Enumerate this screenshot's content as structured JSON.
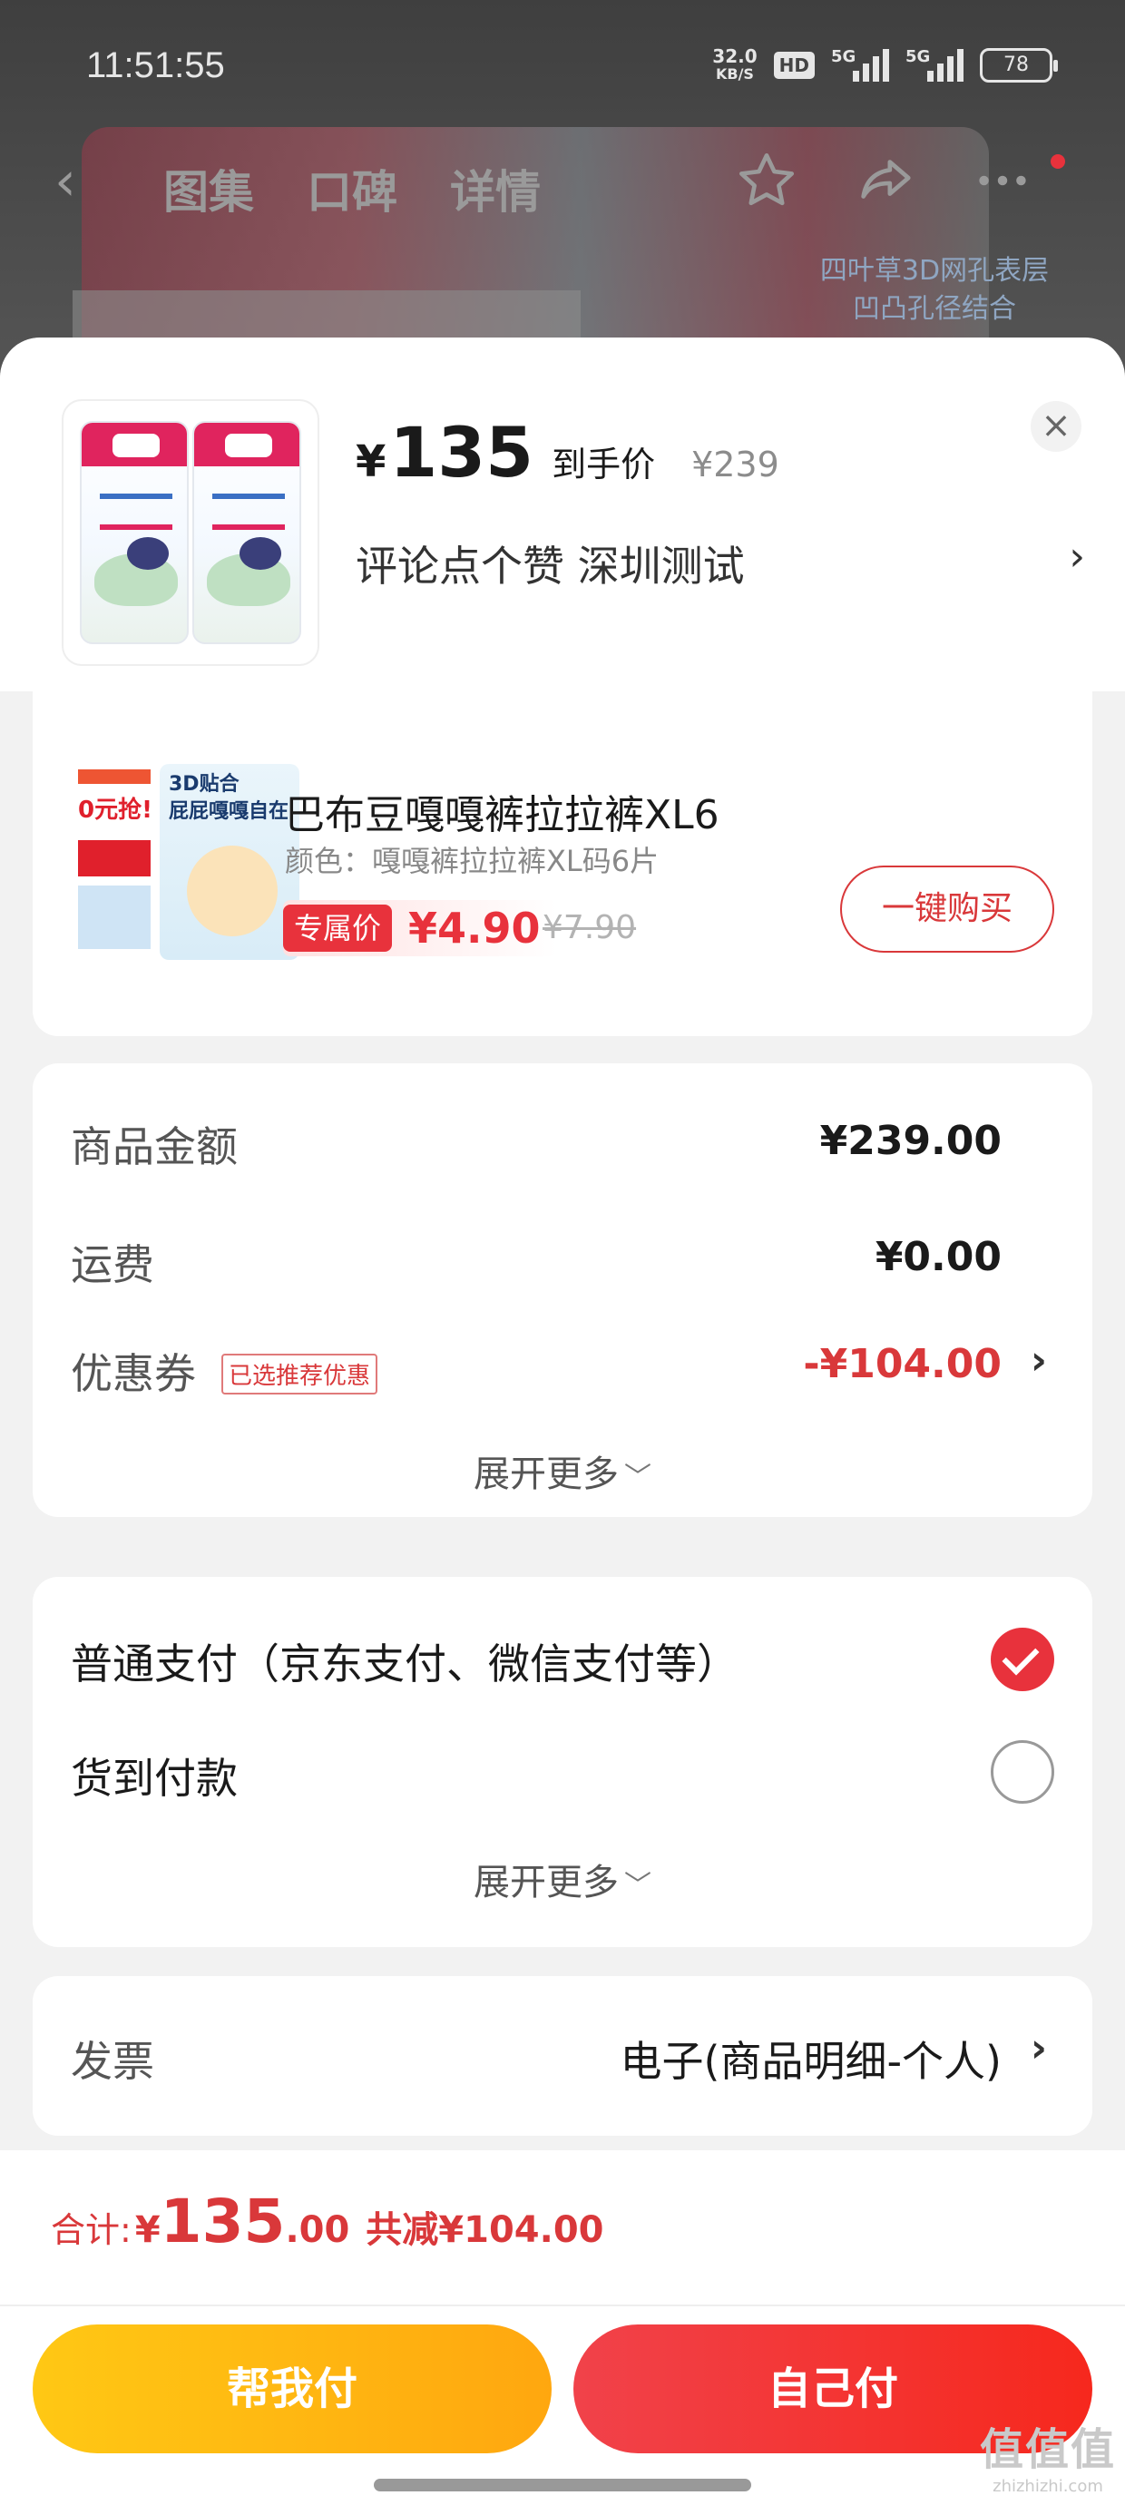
{
  "status_bar": {
    "time": "11:51:55",
    "net_speed": "32.0",
    "net_unit": "KB/S",
    "hd": "HD",
    "sig1": "5G",
    "sig2": "5G",
    "battery": "78"
  },
  "nav": {
    "tabs": [
      "图集",
      "口碑",
      "详情"
    ],
    "promo_line1": "四叶草3D网孔表层",
    "promo_line2": "凹凸孔径结合"
  },
  "sheet_header": {
    "yen": "¥",
    "price": "135",
    "price_label": "到手价",
    "original_price": "¥239",
    "spec": "评论点个赞  深圳测试",
    "close_icon": "close-icon"
  },
  "recommendation": {
    "name": "巴布豆嘎嘎裤拉拉裤XL6",
    "spec": "颜色：嘎嘎裤拉拉裤XL码6片",
    "tag": "专属价",
    "price": "¥4.90",
    "original_price": "¥7.90",
    "buy_label": "一键购买",
    "thumb_line1": "0元抢!",
    "thumb_line2a": "3D贴合",
    "thumb_line2b": "屁屁嘎嘎自在"
  },
  "amount": {
    "goods_label": "商品金额",
    "goods_value": "¥239.00",
    "shipping_label": "运费",
    "shipping_value": "¥0.00",
    "coupon_label": "优惠券",
    "coupon_badge": "已选推荐优惠",
    "coupon_value": "-¥104.00",
    "expand_label": "展开更多"
  },
  "payment": {
    "option1": "普通支付（京东支付、微信支付等）",
    "option2": "货到付款",
    "expand_label": "展开更多",
    "selected": "option1"
  },
  "invoice": {
    "label": "发票",
    "value": "电子(商品明细-个人)"
  },
  "footer": {
    "total_label": "合计:",
    "total_yen": "¥",
    "total_int": "135",
    "total_dec": ".00",
    "total_save": "共减¥104.00",
    "help_pay": "帮我付",
    "self_pay": "自己付"
  },
  "watermark": {
    "logo": "值值值",
    "url": "zhizhizhi.com"
  },
  "colors": {
    "accent_red": "#e8323c",
    "help_yellow": "#ffb40f"
  }
}
